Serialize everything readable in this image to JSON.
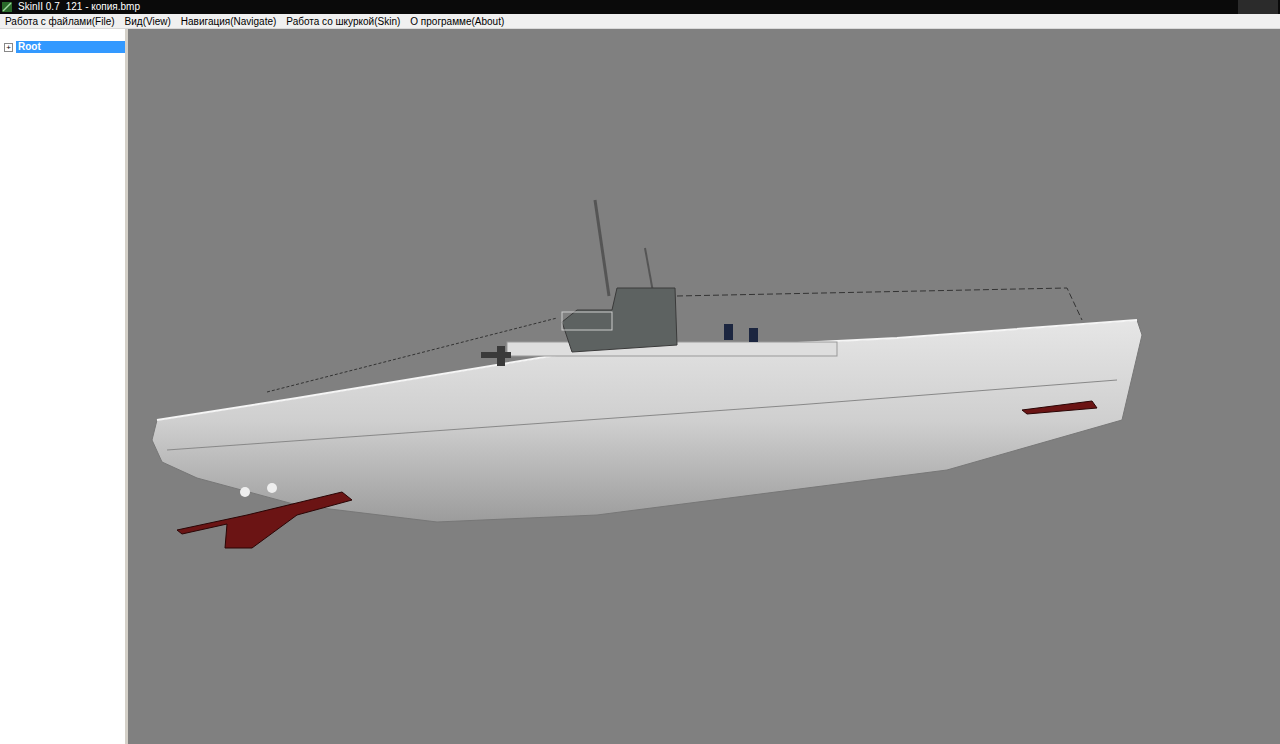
{
  "window": {
    "app": "SkinII 0.7",
    "file": "121 - копия.bmp"
  },
  "menu": [
    {
      "label": "Работа с файлами(File)"
    },
    {
      "label": "Вид(View)"
    },
    {
      "label": "Навигация(Navigate)"
    },
    {
      "label": "Работа со шкуркой(Skin)"
    },
    {
      "label": "О программе(About)"
    }
  ],
  "tree": [
    {
      "label": "Root",
      "expander": "+",
      "expanded": false,
      "selected": true
    }
  ]
}
